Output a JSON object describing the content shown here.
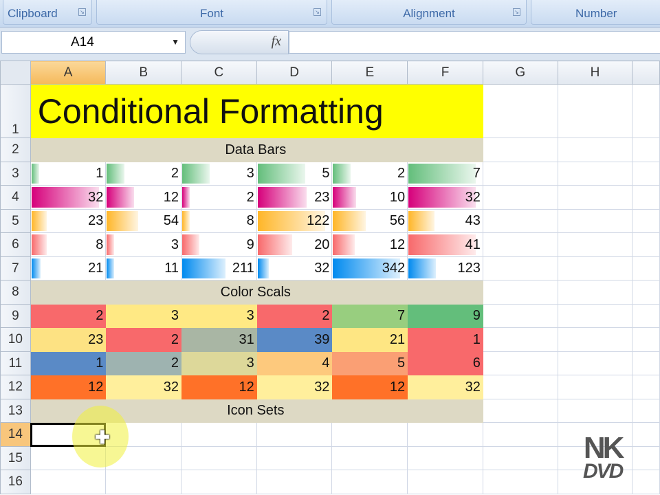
{
  "ribbon": {
    "groups": [
      "Clipboard",
      "Font",
      "Alignment",
      "Number"
    ]
  },
  "formula_bar": {
    "name_box": "A14",
    "fx_label": "fx",
    "formula": ""
  },
  "columns": [
    "A",
    "B",
    "C",
    "D",
    "E",
    "F",
    "G",
    "H"
  ],
  "rows": [
    "1",
    "2",
    "3",
    "4",
    "5",
    "6",
    "7",
    "8",
    "9",
    "10",
    "11",
    "12",
    "13",
    "14",
    "15",
    "16"
  ],
  "title": "Conditional Formatting",
  "sections": {
    "data_bars": "Data Bars",
    "color_scales": "Color Scals",
    "icon_sets": "Icon Sets"
  },
  "data_bars": [
    {
      "color": "#63be7b",
      "values": [
        1,
        2,
        3,
        5,
        2,
        7
      ]
    },
    {
      "color": "#d6007b",
      "values": [
        32,
        12,
        2,
        23,
        10,
        32
      ]
    },
    {
      "color": "#ffb628",
      "values": [
        23,
        54,
        8,
        122,
        56,
        43
      ]
    },
    {
      "color": "#f8696b",
      "values": [
        8,
        3,
        9,
        20,
        12,
        41
      ]
    },
    {
      "color": "#008aef",
      "values": [
        21,
        11,
        211,
        32,
        342,
        123
      ]
    }
  ],
  "color_scales": [
    {
      "values": [
        2,
        3,
        3,
        2,
        7,
        9
      ],
      "colors": [
        "#f8696b",
        "#ffe984",
        "#ffe984",
        "#f8696b",
        "#98ce7f",
        "#63be7b"
      ]
    },
    {
      "values": [
        23,
        2,
        31,
        39,
        21,
        1
      ],
      "colors": [
        "#fde283",
        "#f8696b",
        "#a9b6a4",
        "#5a8ac6",
        "#fee683",
        "#f8696b"
      ]
    },
    {
      "values": [
        1,
        2,
        3,
        4,
        5,
        6
      ],
      "colors": [
        "#5a8ac6",
        "#9eb3b0",
        "#ddd89a",
        "#fdc97d",
        "#fa9f74",
        "#f8696b"
      ]
    },
    {
      "values": [
        12,
        32,
        12,
        32,
        12,
        32
      ],
      "colors": [
        "#ff7128",
        "#ffef9c",
        "#ff7128",
        "#ffef9c",
        "#ff7128",
        "#ffef9c"
      ]
    }
  ],
  "active_cell": "A14",
  "watermark": "NK DVD"
}
